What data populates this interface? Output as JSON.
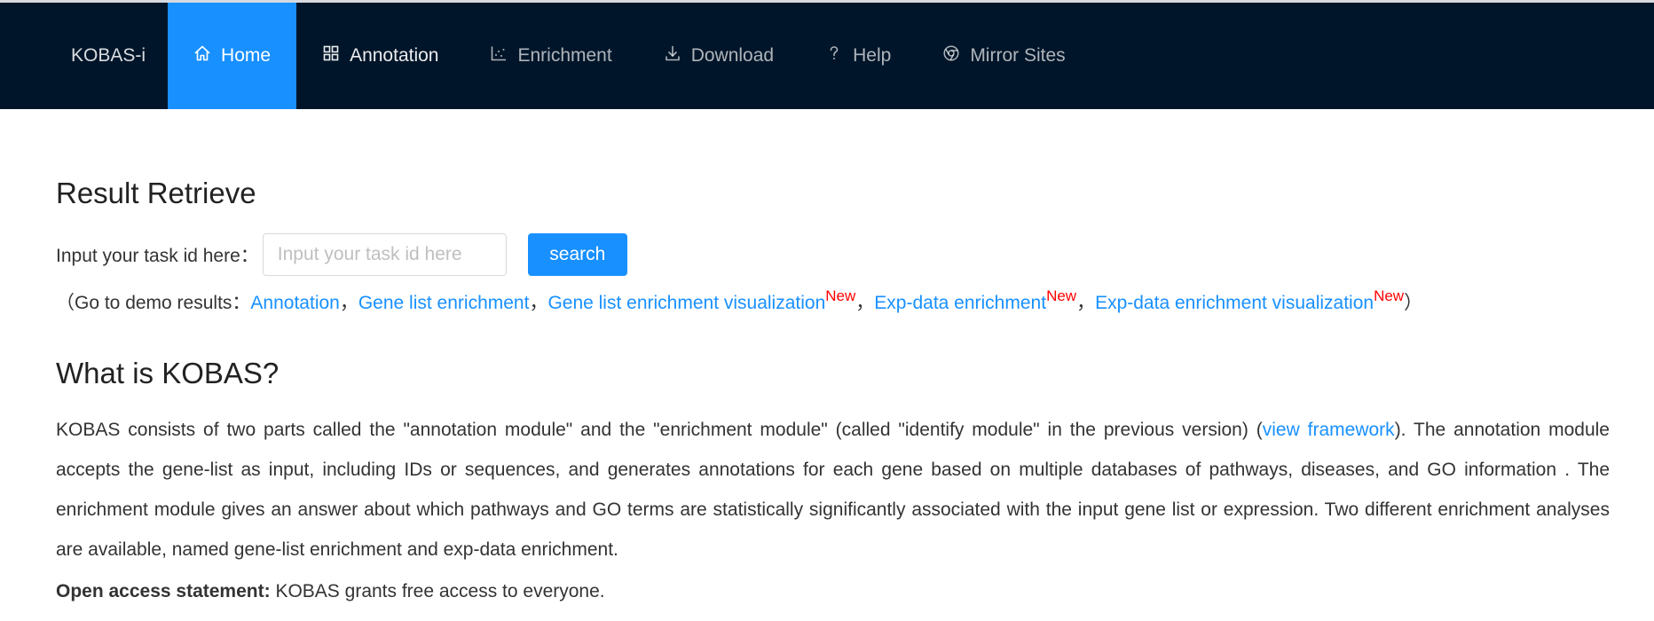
{
  "nav": {
    "logo": "KOBAS-i",
    "items": [
      {
        "label": "Home",
        "icon": "home-icon"
      },
      {
        "label": "Annotation",
        "icon": "grid-icon"
      },
      {
        "label": "Enrichment",
        "icon": "scatter-chart-icon"
      },
      {
        "label": "Download",
        "icon": "download-icon"
      },
      {
        "label": "Help",
        "icon": "question-icon"
      },
      {
        "label": "Mirror Sites",
        "icon": "chrome-icon"
      }
    ],
    "active": "Home"
  },
  "retrieve": {
    "title": "Result Retrieve",
    "label": "Input your task id here：",
    "placeholder": "Input your task id here",
    "value": "",
    "button": "search"
  },
  "demo": {
    "prefix": "（Go to demo results：",
    "sep": "，",
    "new_badge": "New",
    "suffix": "）",
    "links": [
      "Annotation",
      "Gene list enrichment",
      "Gene list enrichment visualization",
      "Exp-data enrichment",
      "Exp-data enrichment visualization"
    ]
  },
  "about": {
    "title": "What is KOBAS?",
    "text_before_link": "KOBAS consists of two parts called the \"annotation module\" and the \"enrichment module\" (called \"identify module\" in the previous version) (",
    "link": "view framework",
    "text_after_link": "). The annotation module accepts the gene-list as input, including IDs or sequences, and generates annotations for each gene based on multiple databases of pathways, diseases, and GO information . The enrichment module gives an answer about which pathways and GO terms are statistically significantly associated with the input gene list or expression. Two different enrichment analyses are available, named gene-list enrichment and exp-data enrichment."
  },
  "statement": {
    "label": "Open access statement:",
    "text": " KOBAS grants free access to everyone."
  },
  "colors": {
    "nav_bg": "#001529",
    "accent": "#1890ff",
    "new_badge": "#ff0000"
  }
}
